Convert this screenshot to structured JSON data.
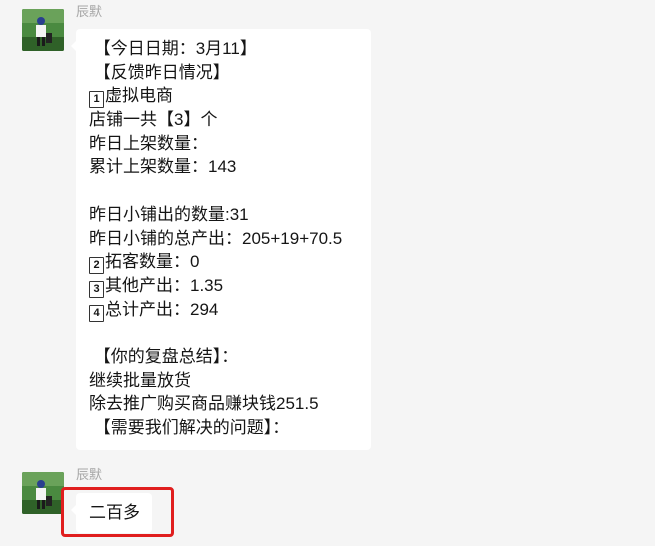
{
  "messages": [
    {
      "sender": "辰默",
      "lines": [
        " 【今日日期：3月11】",
        " 【反馈昨日情况】",
        "1|虚拟电商",
        "店铺一共【3】个",
        "昨日上架数量：",
        "累计上架数量：143",
        "",
        "昨日小铺出的数量:31",
        "昨日小铺的总产出：205+19+70.5",
        "2|拓客数量：0",
        "3|其他产出：1.35",
        "4|总计产出：294",
        "",
        " 【你的复盘总结】：",
        "继续批量放货",
        "除去推广购买商品赚块钱251.5",
        " 【需要我们解决的问题】："
      ]
    },
    {
      "sender": "辰默",
      "text": "二百多"
    }
  ],
  "colors": {
    "background": "#f5f5f5",
    "bubble": "#ffffff",
    "highlight": "#e01e1e",
    "sender_name": "#a6a6a6"
  }
}
